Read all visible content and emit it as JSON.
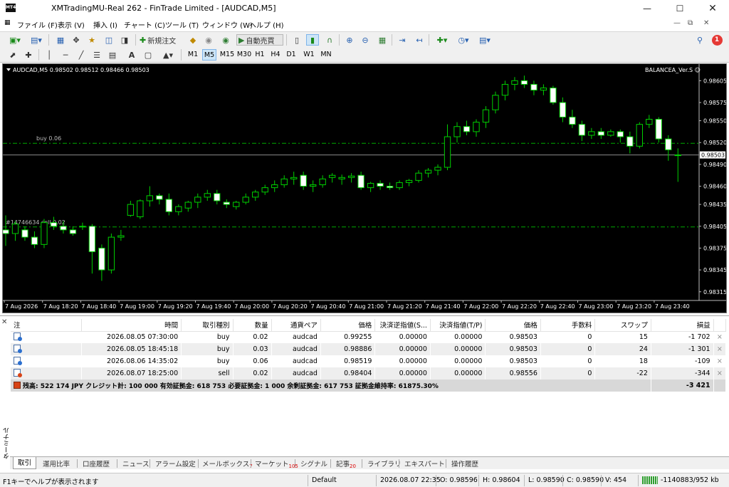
{
  "window": {
    "title": "XMTradingMU-Real 262 - FinTrade Limited - [AUDCAD,M5]",
    "app_icon_text": "MT4",
    "min_icon": "minimize-icon",
    "max_icon": "maximize-icon",
    "close_icon": "close-icon"
  },
  "menu": [
    "ファイル (F)",
    "表示 (V)",
    "挿入 (I)",
    "チャート (C)",
    "ツール (T)",
    "ウィンドウ (W)",
    "ヘルプ (H)"
  ],
  "notifications": {
    "badge": "1"
  },
  "toolbar": {
    "new_order_label": "新規注文",
    "autotrade_label": "自動売買"
  },
  "timeframes": [
    "M1",
    "M5",
    "M15",
    "M30",
    "H1",
    "H4",
    "D1",
    "W1",
    "MN"
  ],
  "active_timeframe": "M5",
  "chart": {
    "header": "AUDCAD,M5  0.98502 0.98512 0.98466 0.98503",
    "ea_label": "BALANCEA_Ver.S ☺",
    "current_price_label": "0.98503",
    "buy_line_label": "buy 0.06",
    "sell_line_label": "#14746634 sell 0.02",
    "bull_color": "#000000",
    "bear_color": "#ffffff",
    "wick_color": "#00d000",
    "grid_color": "#00aa00"
  },
  "chart_data": {
    "type": "candlestick",
    "symbol": "AUDCAD",
    "timeframe": "M5",
    "y_ticks": [
      "0.98605",
      "0.98575",
      "0.98550",
      "0.98520",
      "0.98490",
      "0.98460",
      "0.98435",
      "0.98405",
      "0.98375",
      "0.98345",
      "0.98315"
    ],
    "ylim": [
      0.98305,
      0.9862
    ],
    "x_ticks": [
      "7 Aug 2026",
      "7 Aug 18:20",
      "7 Aug 18:40",
      "7 Aug 19:00",
      "7 Aug 19:20",
      "7 Aug 19:40",
      "7 Aug 20:00",
      "7 Aug 20:20",
      "7 Aug 20:40",
      "7 Aug 21:00",
      "7 Aug 21:20",
      "7 Aug 21:40",
      "7 Aug 22:00",
      "7 Aug 22:20",
      "7 Aug 22:40",
      "7 Aug 23:00",
      "7 Aug 23:20",
      "7 Aug 23:40"
    ],
    "levels": {
      "buy_avg": 0.98519,
      "sell": 0.98404,
      "bid": 0.98503
    },
    "ohlc": [
      [
        0.984,
        0.9842,
        0.98378,
        0.98395
      ],
      [
        0.98395,
        0.98412,
        0.98385,
        0.98408
      ],
      [
        0.984,
        0.98405,
        0.98385,
        0.9839
      ],
      [
        0.9839,
        0.98398,
        0.98375,
        0.9838
      ],
      [
        0.9838,
        0.98415,
        0.98375,
        0.9841
      ],
      [
        0.9841,
        0.98418,
        0.984,
        0.98405
      ],
      [
        0.98405,
        0.98412,
        0.98395,
        0.984
      ],
      [
        0.984,
        0.98405,
        0.98392,
        0.98395
      ],
      [
        0.98405,
        0.9841,
        0.984,
        0.98404
      ],
      [
        0.98405,
        0.98408,
        0.9834,
        0.9837
      ],
      [
        0.98375,
        0.9838,
        0.9833,
        0.98345
      ],
      [
        0.98345,
        0.98395,
        0.9834,
        0.9839
      ],
      [
        0.9839,
        0.984,
        0.98385,
        0.98392
      ],
      [
        0.9842,
        0.9844,
        0.98418,
        0.98435
      ],
      [
        0.98418,
        0.98442,
        0.98415,
        0.9844
      ],
      [
        0.9844,
        0.9846,
        0.98432,
        0.98447
      ],
      [
        0.98447,
        0.9845,
        0.98435,
        0.98442
      ],
      [
        0.98442,
        0.9845,
        0.9842,
        0.98425
      ],
      [
        0.98425,
        0.98435,
        0.9842,
        0.98432
      ],
      [
        0.9843,
        0.9844,
        0.98425,
        0.98438
      ],
      [
        0.98438,
        0.9845,
        0.9843,
        0.98445
      ],
      [
        0.98445,
        0.98455,
        0.9844,
        0.9845
      ],
      [
        0.9845,
        0.98455,
        0.98435,
        0.9844
      ],
      [
        0.98438,
        0.98442,
        0.9843,
        0.98435
      ],
      [
        0.98432,
        0.9844,
        0.98428,
        0.98438
      ],
      [
        0.98438,
        0.9845,
        0.98435,
        0.98445
      ],
      [
        0.98445,
        0.98455,
        0.9844,
        0.98452
      ],
      [
        0.98452,
        0.98462,
        0.98448,
        0.98458
      ],
      [
        0.98458,
        0.98468,
        0.98452,
        0.98462
      ],
      [
        0.98462,
        0.98475,
        0.98458,
        0.9847
      ],
      [
        0.9847,
        0.9848,
        0.98462,
        0.98472
      ],
      [
        0.98475,
        0.9848,
        0.98455,
        0.9846
      ],
      [
        0.9846,
        0.98468,
        0.98452,
        0.98462
      ],
      [
        0.98462,
        0.98475,
        0.98458,
        0.9847
      ],
      [
        0.98472,
        0.98478,
        0.98465,
        0.98475
      ],
      [
        0.9847,
        0.98476,
        0.98462,
        0.98472
      ],
      [
        0.98472,
        0.98478,
        0.98465,
        0.98474
      ],
      [
        0.98475,
        0.9848,
        0.98455,
        0.98458
      ],
      [
        0.98458,
        0.98466,
        0.98452,
        0.98464
      ],
      [
        0.98464,
        0.98468,
        0.98455,
        0.9846
      ],
      [
        0.9846,
        0.98465,
        0.98455,
        0.98458
      ],
      [
        0.98458,
        0.98468,
        0.98455,
        0.98465
      ],
      [
        0.98465,
        0.9847,
        0.9846,
        0.98468
      ],
      [
        0.98468,
        0.98482,
        0.98465,
        0.98478
      ],
      [
        0.98478,
        0.98485,
        0.98472,
        0.98482
      ],
      [
        0.98482,
        0.9849,
        0.98475,
        0.98486
      ],
      [
        0.98486,
        0.98545,
        0.98482,
        0.98528
      ],
      [
        0.98528,
        0.98548,
        0.9852,
        0.98542
      ],
      [
        0.98542,
        0.9855,
        0.9853,
        0.98535
      ],
      [
        0.98535,
        0.98552,
        0.98528,
        0.98548
      ],
      [
        0.98548,
        0.9857,
        0.9854,
        0.98565
      ],
      [
        0.98565,
        0.9859,
        0.9856,
        0.98585
      ],
      [
        0.98585,
        0.98605,
        0.98578,
        0.986
      ],
      [
        0.986,
        0.9861,
        0.98592,
        0.98605
      ],
      [
        0.98605,
        0.98612,
        0.98595,
        0.986
      ],
      [
        0.986,
        0.98605,
        0.98585,
        0.98592
      ],
      [
        0.98592,
        0.986,
        0.98585,
        0.98595
      ],
      [
        0.98595,
        0.98598,
        0.98572,
        0.98575
      ],
      [
        0.98575,
        0.98582,
        0.98548,
        0.98555
      ],
      [
        0.98555,
        0.98565,
        0.9854,
        0.98545
      ],
      [
        0.98545,
        0.9855,
        0.98522,
        0.9853
      ],
      [
        0.9853,
        0.9854,
        0.98525,
        0.98535
      ],
      [
        0.98535,
        0.9854,
        0.98525,
        0.9853
      ],
      [
        0.9853,
        0.98538,
        0.98528,
        0.98535
      ],
      [
        0.98535,
        0.98538,
        0.9852,
        0.98528
      ],
      [
        0.98528,
        0.98535,
        0.98505,
        0.98515
      ],
      [
        0.98515,
        0.98548,
        0.98512,
        0.98545
      ],
      [
        0.98545,
        0.98558,
        0.9854,
        0.98552
      ],
      [
        0.98552,
        0.98555,
        0.9852,
        0.98525
      ],
      [
        0.98525,
        0.9853,
        0.98495,
        0.9851
      ],
      [
        0.98502,
        0.98512,
        0.98466,
        0.98503
      ]
    ]
  },
  "orders": {
    "columns": [
      "注",
      "時間",
      "取引種別",
      "数量",
      "通貨ペア",
      "価格",
      "決済逆指値(S...",
      "決済指値(T/P)",
      "価格",
      "手数料",
      "スワップ",
      "損益"
    ],
    "rows": [
      {
        "time": "2026.08.05 07:30:00",
        "type": "buy",
        "volume": "0.02",
        "symbol": "audcad",
        "price": "0.99255",
        "sl": "0.00000",
        "tp": "0.00000",
        "cur_price": "0.98503",
        "commission": "0",
        "swap": "15",
        "profit": "-1 702",
        "icon": "buy-order-icon"
      },
      {
        "time": "2026.08.05 18:45:18",
        "type": "buy",
        "volume": "0.03",
        "symbol": "audcad",
        "price": "0.98886",
        "sl": "0.00000",
        "tp": "0.00000",
        "cur_price": "0.98503",
        "commission": "0",
        "swap": "24",
        "profit": "-1 301",
        "icon": "buy-order-icon"
      },
      {
        "time": "2026.08.06 14:35:02",
        "type": "buy",
        "volume": "0.06",
        "symbol": "audcad",
        "price": "0.98519",
        "sl": "0.00000",
        "tp": "0.00000",
        "cur_price": "0.98503",
        "commission": "0",
        "swap": "18",
        "profit": "-109",
        "icon": "buy-order-icon"
      },
      {
        "time": "2026.08.07 18:25:00",
        "type": "sell",
        "volume": "0.02",
        "symbol": "audcad",
        "price": "0.98404",
        "sl": "0.00000",
        "tp": "0.00000",
        "cur_price": "0.98556",
        "commission": "0",
        "swap": "-22",
        "profit": "-344",
        "icon": "sell-order-icon"
      }
    ],
    "close_glyph": "×",
    "balance_line": "残高: 522 174 JPY  クレジット計: 100 000  有効証拠金: 618 753  必要証拠金: 1 000  余剰証拠金: 617 753  証拠金維持率: 61875.30%",
    "total_profit": "-3 421"
  },
  "terminal": {
    "vertical_label": "ターミナル",
    "tabs": [
      {
        "label": "取引",
        "count": ""
      },
      {
        "label": "運用比率",
        "count": ""
      },
      {
        "label": "口座履歴",
        "count": ""
      },
      {
        "label": "ニュース",
        "count": ""
      },
      {
        "label": "アラーム設定",
        "count": ""
      },
      {
        "label": "メールボックス",
        "count": "7"
      },
      {
        "label": "マーケット",
        "count": "105"
      },
      {
        "label": "シグナル",
        "count": ""
      },
      {
        "label": "記事",
        "count": "20"
      },
      {
        "label": "ライブラリ",
        "count": ""
      },
      {
        "label": "エキスパート",
        "count": ""
      },
      {
        "label": "操作履歴",
        "count": ""
      }
    ]
  },
  "status": {
    "help": "F1キーでヘルプが表示されます",
    "profile": "Default",
    "datetime": "2026.08.07 22:35",
    "open": "O: 0.98596",
    "high": "H: 0.98604",
    "low": "L: 0.98590",
    "close": "C: 0.98590",
    "volume": "V: 454",
    "traffic": "-1140883/952 kb"
  }
}
